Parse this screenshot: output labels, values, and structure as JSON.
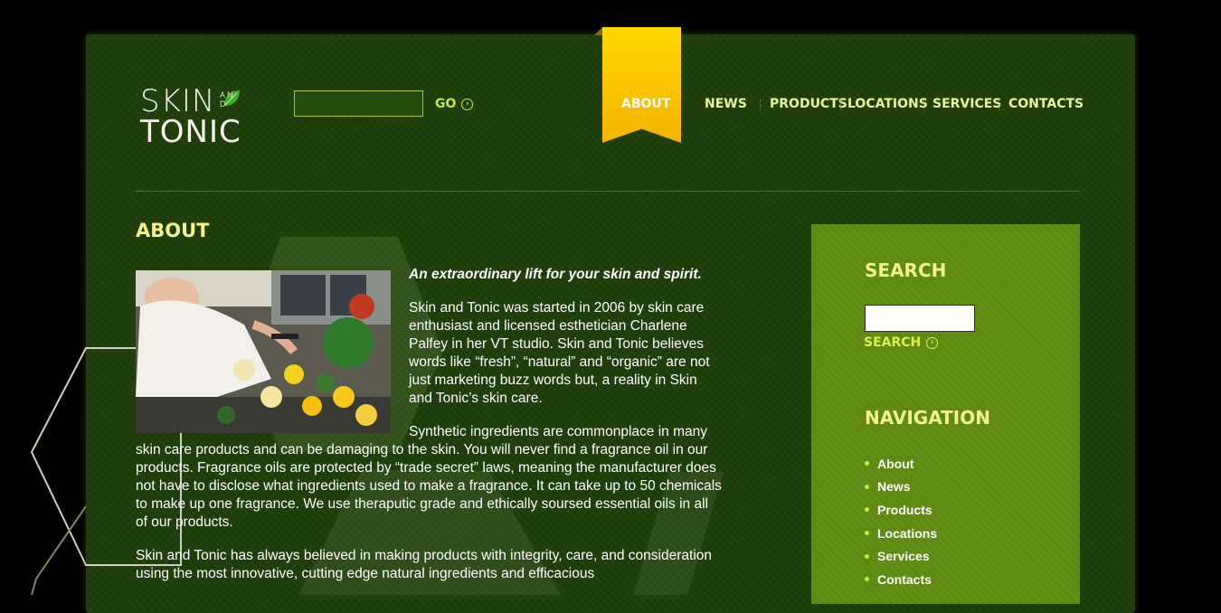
{
  "brand": {
    "line1": "SKIN",
    "line2": "TONIC",
    "and_text": "A N D"
  },
  "header": {
    "search_placeholder": "",
    "go_label": "GO",
    "nav": [
      {
        "label": "ABOUT",
        "active": true
      },
      {
        "label": "NEWS",
        "active": false
      },
      {
        "label": "PRODUCTS",
        "active": false
      },
      {
        "label": "LOCATIONS",
        "active": false
      },
      {
        "label": "SERVICES",
        "active": false
      },
      {
        "label": "CONTACTS",
        "active": false
      }
    ]
  },
  "main": {
    "heading": "ABOUT",
    "tagline": "An extraordinary lift for your skin and spirit.",
    "para1": "Skin and Tonic was started in 2006 by skin care enthusiast and licensed esthetician Charlene Palfey in her VT studio. Skin and Tonic believes words like “fresh”, “natural” and “organic” are not just marketing buzz words but, a reality in Skin and Tonic’s skin care.",
    "para2": "Synthetic ingredients are commonplace in many skin care products and can be damaging to the skin. You will never find a fragrance oil in our products. Fragrance oils are protected by “trade secret” laws, meaning the manufacturer does not have to disclose what ingredients used to make a fragrance. It can take up to 50 chemicals to make up one fragrance. We use theraputic grade and ethically soursed essential oils in all of our products.",
    "para3": "Skin and Tonic has always believed in making products with integrity, care, and consideration using the most innovative, cutting edge natural ingredients and efficacious"
  },
  "sidebar": {
    "search_heading": "SEARCH",
    "search_button": "SEARCH",
    "nav_heading": "NAVIGATION",
    "nav_items": [
      "About",
      "News",
      "Products",
      "Locations",
      "Services",
      "Contacts"
    ]
  },
  "colors": {
    "accent": "#f3f28c",
    "ribbon": "#ffd800",
    "sidebar": "#5e8a10",
    "background": "#1f3f0a"
  }
}
